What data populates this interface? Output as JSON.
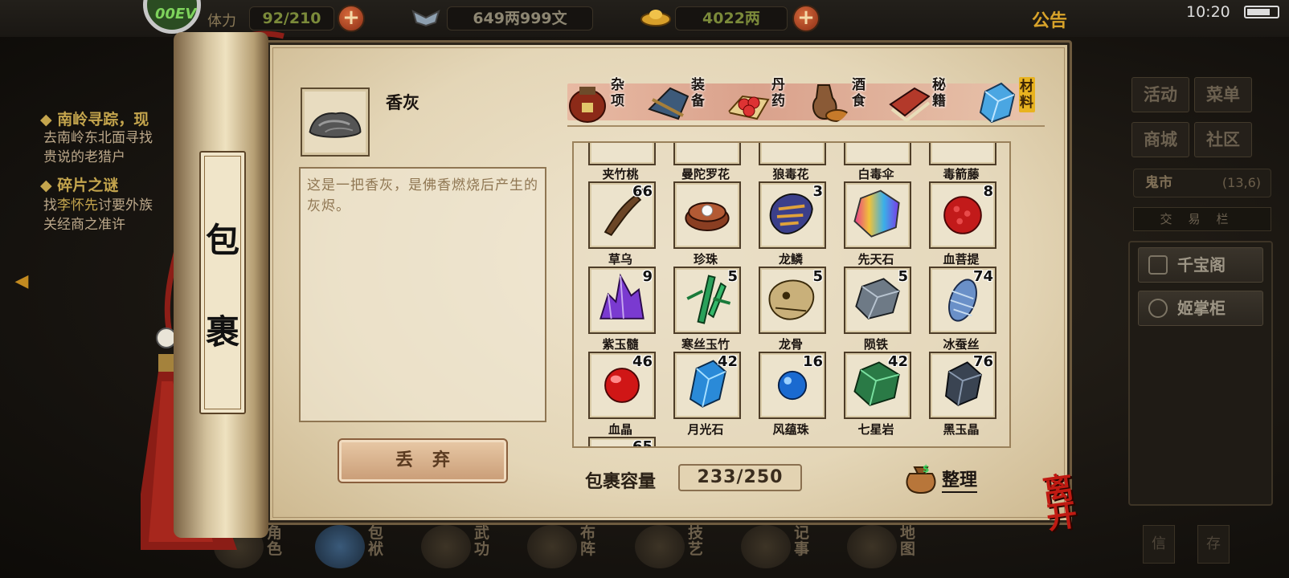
{
  "top": {
    "level": "00EV",
    "stamina_label": "体力",
    "stamina": "92/210",
    "silver": "649两999文",
    "gold": "4022两",
    "notice": "公告",
    "time": "10:20"
  },
  "quests": [
    {
      "title": "南岭寻踪，现",
      "desc_lines": [
        "去南岭东北面寻找",
        "贵说的老猎户"
      ]
    },
    {
      "title": "碎片之谜",
      "desc_pre": "找",
      "desc_highlight": "李怀先",
      "desc_post": "讨要外族",
      "desc_line2": "关经商之准许"
    }
  ],
  "right_menu": {
    "activity": "活动",
    "menu": "菜单",
    "mall": "商城",
    "community": "社区",
    "location": "鬼市",
    "coords": "(13,6)",
    "tabs_text": "交易栏",
    "npc1": "千宝阁",
    "npc2": "姬掌柜",
    "btn1": "信",
    "btn2": "存"
  },
  "bottom_nav": [
    "角色",
    "包袱",
    "武功",
    "布阵",
    "技艺",
    "记事",
    "地图"
  ],
  "bag": {
    "title_char1": "包",
    "title_char2": "裹",
    "selected_name": "香灰",
    "selected_desc": "这是一把香灰，是佛香燃烧后产生的灰烬。",
    "drop_label": "丢弃",
    "capacity_label": "包裹容量",
    "capacity": "233/250",
    "sort_label": "整理",
    "leave_label": "离开",
    "tabs": [
      "杂项",
      "装备",
      "丹药",
      "酒食",
      "秘籍",
      "材料"
    ],
    "active_tab": "材料",
    "partial_row": [
      "夹竹桃",
      "曼陀罗花",
      "狼毒花",
      "白毒伞",
      "毒箭藤"
    ],
    "items": [
      {
        "name": "草乌",
        "count": "66",
        "icon": "root-icon"
      },
      {
        "name": "珍珠",
        "count": "",
        "icon": "pearl-icon"
      },
      {
        "name": "龙鳞",
        "count": "3",
        "icon": "scale-icon"
      },
      {
        "name": "先天石",
        "count": "",
        "icon": "rainbow-stone-icon"
      },
      {
        "name": "血菩提",
        "count": "8",
        "icon": "red-berry-icon"
      },
      {
        "name": "紫玉髓",
        "count": "9",
        "icon": "purple-crystal-icon"
      },
      {
        "name": "寒丝玉竹",
        "count": "5",
        "icon": "bamboo-icon"
      },
      {
        "name": "龙骨",
        "count": "5",
        "icon": "dragon-skull-icon"
      },
      {
        "name": "陨铁",
        "count": "5",
        "icon": "iron-ore-icon"
      },
      {
        "name": "冰蚕丝",
        "count": "74",
        "icon": "silk-cocoon-icon"
      },
      {
        "name": "血晶",
        "count": "46",
        "icon": "red-orb-icon"
      },
      {
        "name": "月光石",
        "count": "42",
        "icon": "blue-crystal-icon"
      },
      {
        "name": "风蕴珠",
        "count": "16",
        "icon": "blue-orb-icon"
      },
      {
        "name": "七星岩",
        "count": "42",
        "icon": "green-rock-icon"
      },
      {
        "name": "黑玉晶",
        "count": "76",
        "icon": "black-gem-icon"
      }
    ],
    "next_row_count": "65"
  },
  "colors": {
    "accent_gold": "#d8a32a",
    "quest_gold": "#c4a54d",
    "parchment": "#e4d6b7"
  }
}
